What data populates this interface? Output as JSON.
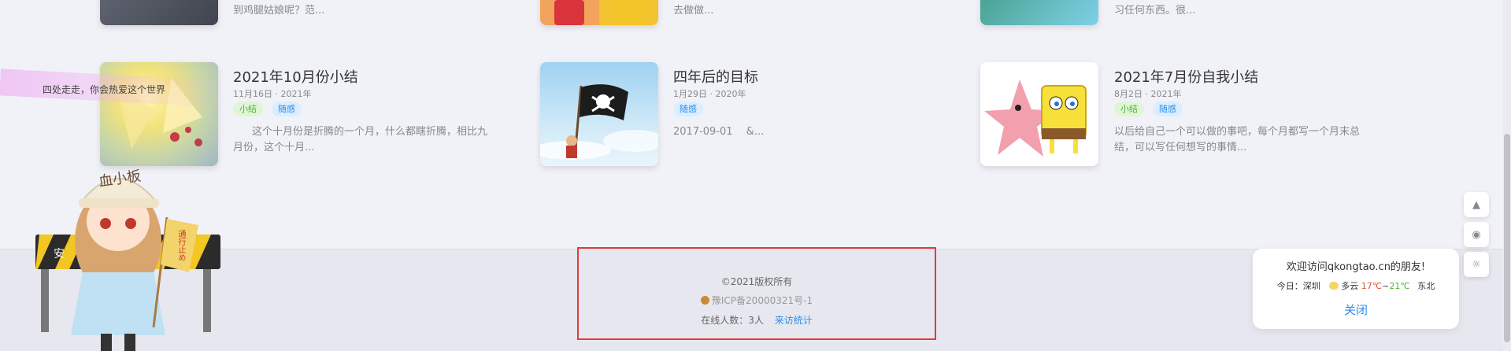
{
  "top_row": [
    {
      "excerpt": "到鸡腿姑娘呢？范..."
    },
    {
      "excerpt": "去做做..."
    },
    {
      "excerpt": "习任何东西。很..."
    }
  ],
  "articles": [
    {
      "title": "2021年10月份小结",
      "meta": "11月16日 · 2021年",
      "tags": [
        "小结",
        "随感"
      ],
      "excerpt_line1": "这个十月份是折腾的一个月，什么都瞎折腾，相比九",
      "excerpt_line2": "月份，这个十月..."
    },
    {
      "title": "四年后的目标",
      "meta": "1月29日 · 2020年",
      "tags": [
        "随感"
      ],
      "excerpt_line1": "2017-09-01　 &...",
      "excerpt_line2": ""
    },
    {
      "title": "2021年7月份自我小结",
      "meta": "8月2日 · 2021年",
      "tags": [
        "小结",
        "随感"
      ],
      "excerpt_line1": "以后给自己一个可以做的事吧，每个月都写一个月末总",
      "excerpt_line2": "结，可以写任何想写的事情..."
    }
  ],
  "mascot": {
    "banner_text": "四处走走，你会热爱这个世界",
    "hat_text": "血小板",
    "flag_text": "通行止め",
    "sign_text": "安"
  },
  "footer": {
    "copyright": "©2021版权所有",
    "icp": "豫ICP备20000321号-1",
    "online_label": "在线人数：3人",
    "stats_link": "来访统计"
  },
  "weather": {
    "greeting": "欢迎访问qkongtao.cn的朋友!",
    "today_label": "今日：",
    "city": "深圳",
    "condition": "多云",
    "temp_low": "17℃",
    "temp_sep": "~",
    "temp_high": "21℃",
    "wind": "东北",
    "close_label": "关闭"
  },
  "float_buttons": [
    "rocket-icon",
    "headset-icon",
    "sun-icon"
  ],
  "colors": {
    "accent": "#2d8cf0",
    "tag_green": "#52b03a",
    "highlight_box": "#e23b3b",
    "temp_low": "#e0552e",
    "temp_high": "#52b03a"
  }
}
